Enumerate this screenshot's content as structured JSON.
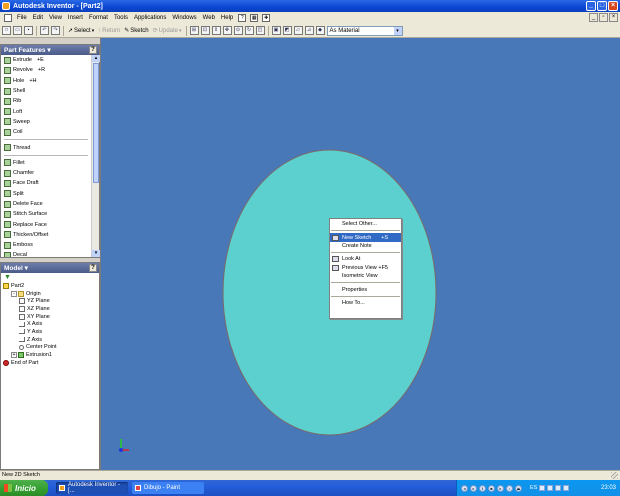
{
  "window": {
    "title": "Autodesk Inventor - [Part2]",
    "buttons": [
      "_",
      "□",
      "×"
    ]
  },
  "menubar": {
    "items": [
      "File",
      "Edit",
      "View",
      "Insert",
      "Format",
      "Tools",
      "Applications",
      "Windows",
      "Web",
      "Help"
    ]
  },
  "toolbar": {
    "select_label": "Select",
    "return_label": "Return",
    "sketch_label": "Sketch",
    "update_label": "Update",
    "material_value": "As Material"
  },
  "features_panel": {
    "title": "Part Features",
    "help": "?",
    "items": [
      {
        "label": "Extrude",
        "accel": "+E"
      },
      {
        "label": "Revolve",
        "accel": "+R"
      },
      {
        "label": "Hole",
        "accel": "+H"
      },
      {
        "label": "Shell",
        "accel": ""
      },
      {
        "label": "Rib",
        "accel": ""
      },
      {
        "label": "Loft",
        "accel": ""
      },
      {
        "label": "Sweep",
        "accel": ""
      },
      {
        "label": "Coil",
        "accel": ""
      },
      {
        "label": "Thread",
        "accel": ""
      },
      {
        "label": "Fillet",
        "accel": ""
      },
      {
        "label": "Chamfer",
        "accel": ""
      },
      {
        "label": "Face Draft",
        "accel": ""
      },
      {
        "label": "Split",
        "accel": ""
      },
      {
        "label": "Delete Face",
        "accel": ""
      },
      {
        "label": "Stitch Surface",
        "accel": ""
      },
      {
        "label": "Replace Face",
        "accel": ""
      },
      {
        "label": "Thicken/Offset",
        "accel": ""
      },
      {
        "label": "Emboss",
        "accel": ""
      },
      {
        "label": "Decal",
        "accel": ""
      }
    ]
  },
  "model_panel": {
    "title": "Model",
    "help": "?",
    "tree": [
      {
        "label": "Part2",
        "icon": "part",
        "level": 0,
        "expander": ""
      },
      {
        "label": "Origin",
        "icon": "folder",
        "level": 1,
        "expander": "-"
      },
      {
        "label": "YZ Plane",
        "icon": "plane",
        "level": 2,
        "expander": ""
      },
      {
        "label": "XZ Plane",
        "icon": "plane",
        "level": 2,
        "expander": ""
      },
      {
        "label": "XY Plane",
        "icon": "plane",
        "level": 2,
        "expander": ""
      },
      {
        "label": "X Axis",
        "icon": "axis",
        "level": 2,
        "expander": ""
      },
      {
        "label": "Y Axis",
        "icon": "axis",
        "level": 2,
        "expander": ""
      },
      {
        "label": "Z Axis",
        "icon": "axis",
        "level": 2,
        "expander": ""
      },
      {
        "label": "Center Point",
        "icon": "point",
        "level": 2,
        "expander": ""
      },
      {
        "label": "Extrusion1",
        "icon": "extr",
        "level": 1,
        "expander": "+"
      },
      {
        "label": "End of Part",
        "icon": "end",
        "level": 0,
        "expander": ""
      }
    ]
  },
  "context_menu": {
    "items": [
      {
        "label": "Select Other...",
        "shortcut": "",
        "highlight": false,
        "icon": false
      },
      {
        "sep": true
      },
      {
        "label": "New Sketch",
        "shortcut": "+S",
        "highlight": true,
        "icon": true
      },
      {
        "label": "Create Note",
        "shortcut": "",
        "highlight": false,
        "icon": false
      },
      {
        "sep": true
      },
      {
        "label": "Look At",
        "shortcut": "",
        "highlight": false,
        "icon": true
      },
      {
        "label": "Previous View",
        "shortcut": "+F5",
        "highlight": false,
        "icon": true
      },
      {
        "label": "Isometric View",
        "shortcut": "",
        "highlight": false,
        "icon": false
      },
      {
        "sep": true
      },
      {
        "label": "Properties",
        "shortcut": "",
        "highlight": false,
        "icon": false
      },
      {
        "sep": true
      },
      {
        "label": "How To...",
        "shortcut": "",
        "highlight": false,
        "icon": false
      }
    ]
  },
  "status": {
    "text": "New 2D Sketch"
  },
  "taskbar": {
    "start_label": "Inicio",
    "tasks": [
      "Autodesk Inventor - [...",
      "Dibujo - Paint"
    ],
    "language": "ES",
    "clock": "23:03"
  },
  "colors": {
    "canvas_bg": "#4878b8",
    "part_face": "#5ccfcf",
    "part_edge": "#7a6a6a",
    "menu_highlight": "#316ac5"
  }
}
